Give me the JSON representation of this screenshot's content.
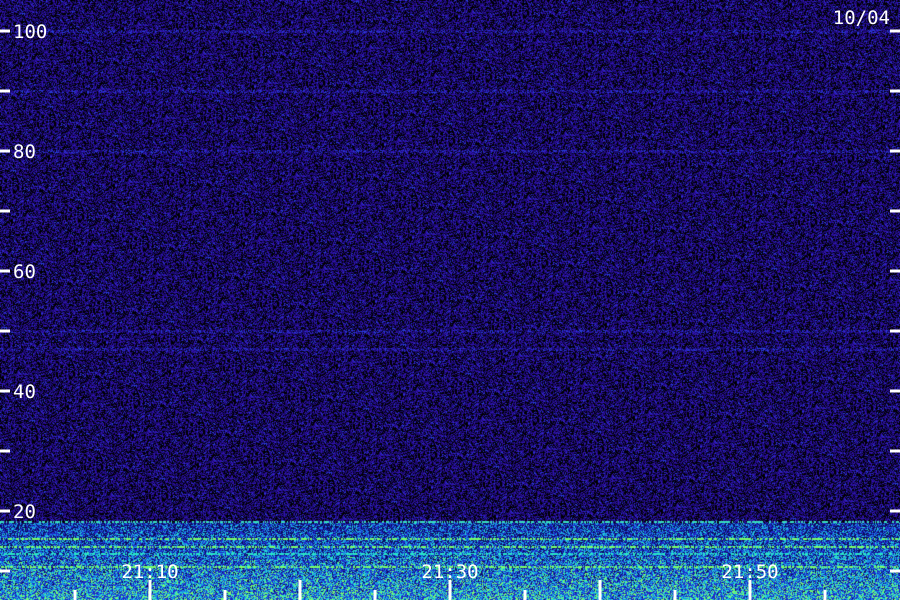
{
  "chart_data": {
    "type": "heatmap",
    "title": "",
    "date_label": "10/04",
    "xlabel": "",
    "ylabel": "",
    "ylim": [
      0,
      100
    ],
    "y_tick_values": [
      10,
      20,
      30,
      40,
      50,
      60,
      70,
      80,
      90,
      100
    ],
    "y_tick_labels": [
      {
        "value": 100,
        "text": "100"
      },
      {
        "value": 80,
        "text": "80"
      },
      {
        "value": 60,
        "text": "60"
      },
      {
        "value": 40,
        "text": "40"
      },
      {
        "value": 20,
        "text": "20"
      }
    ],
    "x_tick_labels": [
      "21:10",
      "21:30",
      "21:50"
    ],
    "x_minor_tick_count": 12,
    "colormap": [
      "#000000",
      "#1a0a6e",
      "#3a1ad0",
      "#1f4fe0",
      "#18a0e6",
      "#28e8c8",
      "#7bff6a"
    ],
    "background_level": "dark violet noise",
    "horizontal_lines": [
      100,
      90,
      80,
      50,
      47
    ],
    "intense_band": [
      0,
      18
    ]
  }
}
